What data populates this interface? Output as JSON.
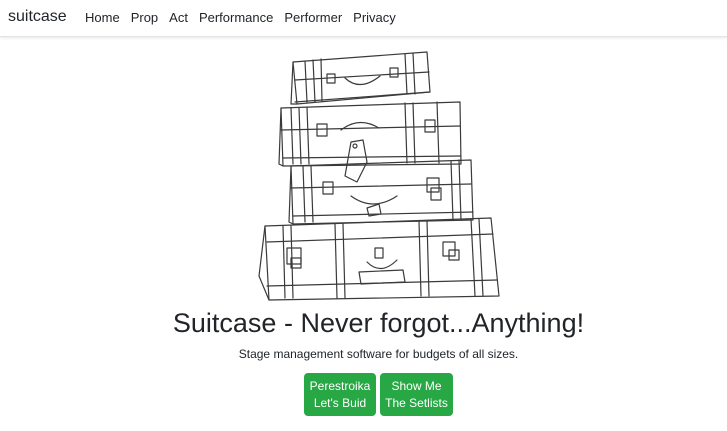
{
  "navbar": {
    "brand": "suitcase",
    "links": [
      "Home",
      "Prop",
      "Act",
      "Performance",
      "Performer",
      "Privacy"
    ]
  },
  "hero": {
    "headline": "Suitcase - Never forgot...Anything!",
    "tagline": "Stage management software for budgets of all sizes.",
    "buttons": [
      {
        "line1": "Perestroika",
        "line2": "Let's Buid"
      },
      {
        "line1": "Show Me",
        "line2": "The Setlists"
      }
    ]
  },
  "colors": {
    "button_green": "#28a745",
    "text": "#212529",
    "background": "#ffffff"
  },
  "image": {
    "subject": "stacked-suitcases-sketch"
  }
}
